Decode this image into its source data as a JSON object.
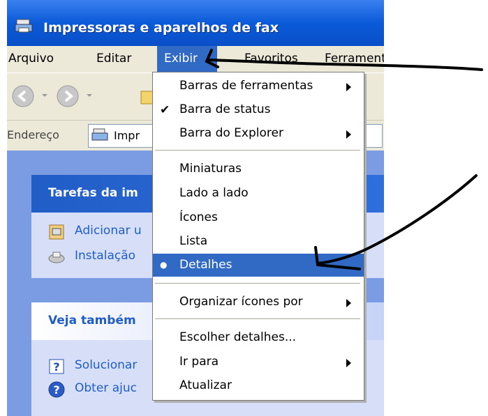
{
  "window": {
    "title": "Impressoras e aparelhos de fax"
  },
  "menubar": {
    "items": [
      "Arquivo",
      "Editar",
      "Exibir",
      "Favoritos",
      "Ferramenta"
    ]
  },
  "addressbar": {
    "label": "Endereço",
    "value": "Impr"
  },
  "taskpanes": [
    {
      "title": "Tarefas da im",
      "links": [
        "Adicionar u",
        "Instalação"
      ]
    },
    {
      "title": "Veja também",
      "links": [
        "Solucionar",
        "Obter ajuc"
      ]
    }
  ],
  "exibir_menu": {
    "items": [
      {
        "label": "Barras de ferramentas",
        "submenu": true
      },
      {
        "label": "Barra de status",
        "checked": true
      },
      {
        "label": "Barra do Explorer",
        "submenu": true
      },
      {
        "label": "Miniaturas"
      },
      {
        "label": "Lado a lado"
      },
      {
        "label": "Ícones"
      },
      {
        "label": "Lista"
      },
      {
        "label": "Detalhes",
        "selected": true,
        "highlighted": true
      },
      {
        "label": "Organizar ícones por",
        "submenu": true
      },
      {
        "label": "Escolher detalhes..."
      },
      {
        "label": "Ir para",
        "submenu": true
      },
      {
        "label": "Atualizar"
      }
    ],
    "check_glyph": "✔",
    "bullet_glyph": "●"
  },
  "colors": {
    "title_bar": "#0b5ad8",
    "menu_highlight": "#316ac5",
    "link": "#215dc6"
  }
}
